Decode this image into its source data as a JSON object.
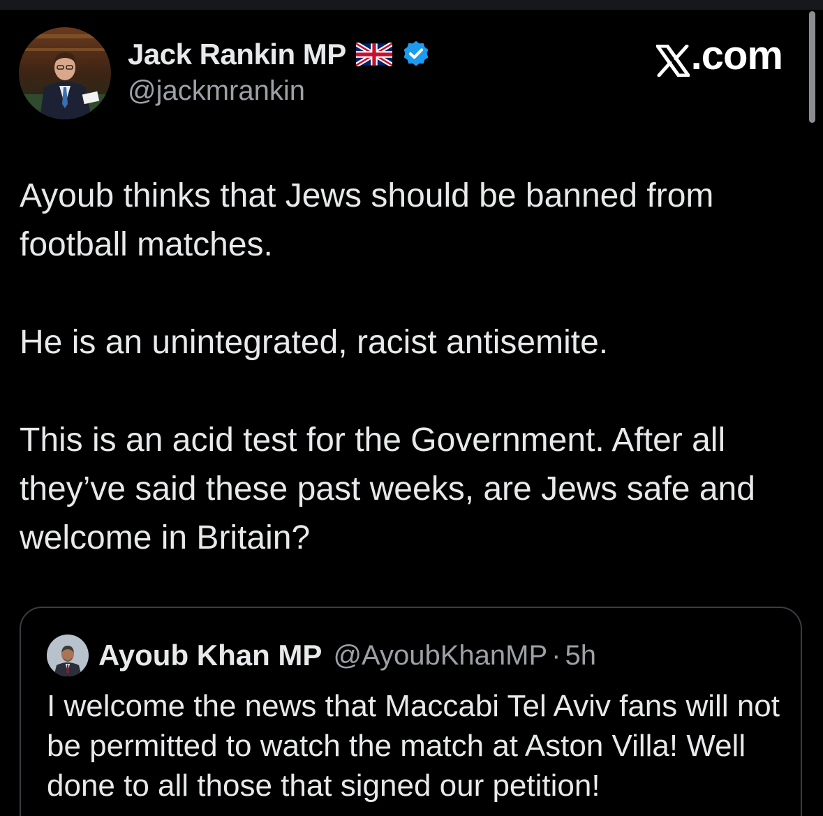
{
  "author": {
    "display_name": "Jack Rankin MP",
    "handle": "@jackmrankin",
    "flag_icon": "uk-flag-icon",
    "verified_icon": "verified-badge-icon",
    "verified_color": "#1d9bf0"
  },
  "brand": {
    "text": ".com",
    "logo_icon": "x-logo-icon"
  },
  "tweet": {
    "paragraphs": [
      "Ayoub thinks that Jews should be banned from football matches.",
      "He is an unintegrated, racist antisemite.",
      "This is an acid test for the Government. After all they’ve said these past weeks, are Jews safe and welcome in Britain?"
    ]
  },
  "quote": {
    "display_name": "Ayoub Khan MP",
    "handle": "@AyoubKhanMP",
    "separator": "·",
    "time": "5h",
    "text": "I welcome the news that Maccabi Tel Aviv fans will not be permitted to watch the match at Aston Villa! Well done to all those that signed our petition!"
  },
  "colors": {
    "background": "#000000",
    "text_primary": "#e7e9ea",
    "text_secondary": "#9ca1a6",
    "border": "#3a3d41"
  }
}
